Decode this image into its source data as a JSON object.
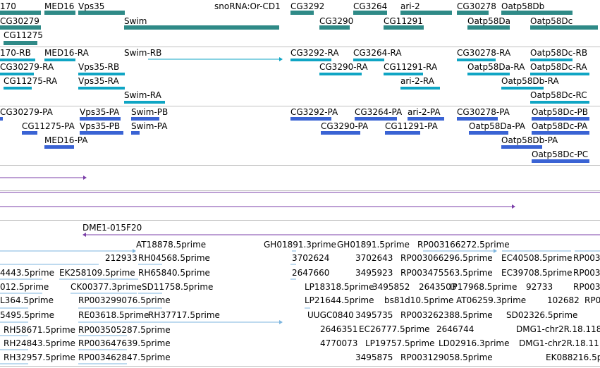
{
  "colors": {
    "gene": "#2f8a87",
    "transcript": "#0fa5c4",
    "protein": "#3a63d4",
    "alignment": "#7b3fa8",
    "est": "#7eb6df"
  },
  "gene_track": {
    "labels": [
      "170",
      "MED16",
      "Vps35",
      "snoRNA:Or-CD1",
      "CG3292",
      "CG3264",
      "ari-2",
      "CG30278",
      "Oatp58Db",
      "CG30279",
      "Swim",
      "CG3290",
      "CG11291",
      "Oatp58Da",
      "Oatp58Dc",
      "CG11275"
    ]
  },
  "transcript_track": {
    "labels": [
      "170-RB",
      "MED16-RA",
      "Swim-RB",
      "CG3292-RA",
      "CG3264-RA",
      "CG30278-RA",
      "Oatp58Dc-RB",
      "CG30279-RA",
      "Vps35-RB",
      "CG3290-RA",
      "CG11291-RA",
      "Oatp58Da-RA",
      "Oatp58Dc-RA",
      "CG11275-RA",
      "Vps35-RA",
      "ari-2-RA",
      "Oatp58Db-RA",
      "Swim-RA",
      "Oatp58Dc-RC"
    ]
  },
  "protein_track": {
    "labels": [
      "CG30279-PA",
      "Vps35-PA",
      "Swim-PB",
      "CG3292-PA",
      "CG3264-PA",
      "ari-2-PA",
      "CG30278-PA",
      "Oatp58Dc-PB",
      "CG11275-PA",
      "Vps35-PB",
      "Swim-PA",
      "CG3290-PA",
      "CG11291-PA",
      "Oatp58Da-PA",
      "Oatp58Dc-PA",
      "MED16-PA",
      "Oatp58Db-PA",
      "Oatp58Dc-PC"
    ]
  },
  "alignment_track": {
    "labels": [
      "DME1-015F20"
    ]
  },
  "est_track": {
    "labels": [
      "AT18878.5prime",
      "GH01891.3prime",
      "GH01891.5prime",
      "RP003166272.5prime",
      "212933",
      "RH04568.5prime",
      "3702624",
      "3702643",
      "RP003066296.5prime",
      "EC40508.5prime",
      "RP003",
      "4443.5prime",
      "EK258109.5prime",
      "RH65840.5prime",
      "2647660",
      "3495923",
      "RP003475563.5prime",
      "EC39708.5prime",
      "RP003",
      "012.5prime",
      "CK00377.3prime",
      "SD11758.5prime",
      "LP18318.5prime",
      "3495852",
      "2643503",
      "IP17968.5prime",
      "92733",
      "RP003",
      "L364.5prime",
      "RP003299076.5prime",
      "LP21644.5prime",
      "bs81d10.5prime",
      "AT06259.3prime",
      "102682",
      "RP00",
      "5495.5prime",
      "RE03618.5prime",
      "RH37717.5prime",
      "UUGC0840",
      "3495735",
      "RP003262388.5prime",
      "SD02326.5prime",
      "2646351",
      "EC26777.5prime",
      "2646744",
      "DMG1-chr2R.18.118",
      "RH58671.5prime",
      "RP003505287.5prime",
      "4770073",
      "LP19757.5prime",
      "LD02916.3prime",
      "DMG1-chr2R.18.11",
      "RH24843.5prime",
      "RP003647639.5prime",
      "3495875",
      "RP003129058.5prime",
      "EK088216.5prime",
      "RH32957.5prime",
      "RP003462847.5prime"
    ]
  }
}
